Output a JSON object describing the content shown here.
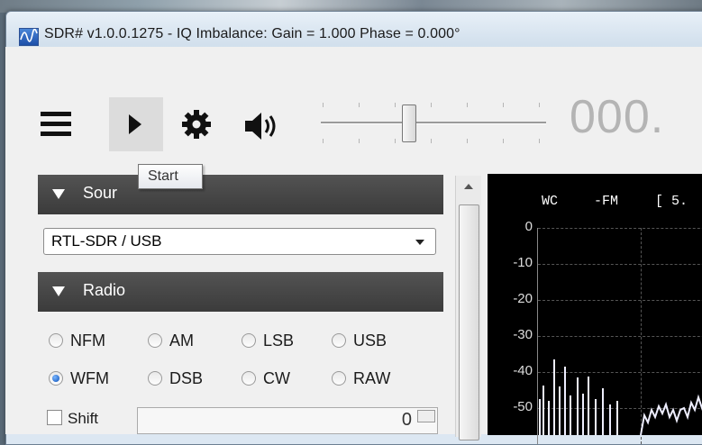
{
  "window": {
    "title": "SDR# v1.0.0.1275 - IQ Imbalance: Gain = 1.000 Phase = 0.000°"
  },
  "toolbar": {
    "menu_icon": "hamburger-menu-icon",
    "play_icon": "play-icon",
    "settings_icon": "gear-icon",
    "audio_icon": "speaker-icon",
    "volume_level": 0.4,
    "frequency_display": "000."
  },
  "tooltip": {
    "text": "Start"
  },
  "source_panel": {
    "header": "Sour",
    "device": "RTL-SDR / USB"
  },
  "radio_panel": {
    "header": "Radio",
    "modes": [
      "NFM",
      "AM",
      "LSB",
      "USB",
      "WFM",
      "DSB",
      "CW",
      "RAW"
    ],
    "selected": "WFM",
    "shift_label": "Shift",
    "shift_value": "0"
  },
  "spectrum": {
    "label_wc": "WC",
    "label_fm": "-FM",
    "label_bracket": "[ 5.",
    "y_ticks": [
      "0",
      "-10",
      "-20",
      "-30",
      "-40",
      "-50"
    ]
  }
}
